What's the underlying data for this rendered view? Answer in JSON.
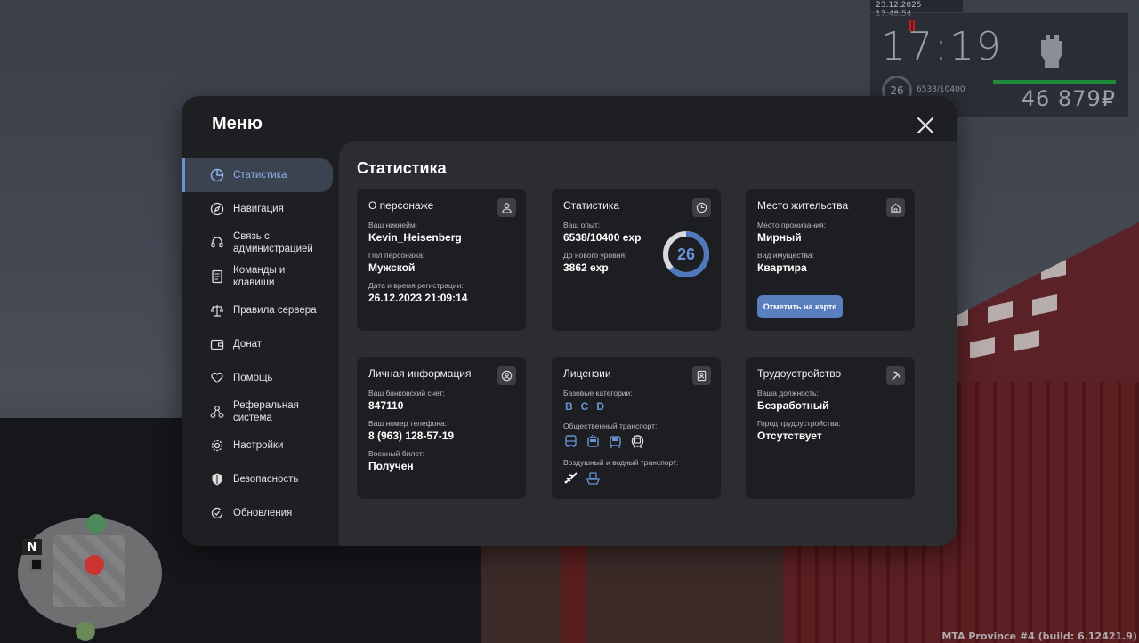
{
  "hud": {
    "datetime": "23.12.2025 17:48:54",
    "time": "17:19",
    "level": "26",
    "exp": "6538/10400",
    "money": "46 879₽"
  },
  "minimap": {
    "north": "N"
  },
  "build": "MTA Province #4 (build: 6.12421.9)",
  "menu": {
    "title": "Меню",
    "sidebar": [
      {
        "label": "Статистика",
        "icon": "pie-chart-icon",
        "active": true
      },
      {
        "label": "Навигация",
        "icon": "compass-icon"
      },
      {
        "label": "Связь с администрацией",
        "icon": "headset-icon"
      },
      {
        "label": "Команды и клавиши",
        "icon": "document-icon"
      },
      {
        "label": "Правила сервера",
        "icon": "scales-icon"
      },
      {
        "label": "Донат",
        "icon": "wallet-icon"
      },
      {
        "label": "Помощь",
        "icon": "heart-hand-icon"
      },
      {
        "label": "Реферальная система",
        "icon": "network-icon"
      },
      {
        "label": "Настройки",
        "icon": "gear-icon"
      },
      {
        "label": "Безопасность",
        "icon": "shield-icon"
      },
      {
        "label": "Обновления",
        "icon": "refresh-check-icon"
      }
    ],
    "content_title": "Статистика",
    "cards": {
      "character": {
        "title": "О персонаже",
        "nickname_label": "Ваш никнейм:",
        "nickname": "Kevin_Heisenberg",
        "gender_label": "Пол персонажа:",
        "gender": "Мужской",
        "reg_label": "Дата и время регистрации:",
        "reg": "26.12.2023 21:09:14"
      },
      "stats": {
        "title": "Статистика",
        "exp_label": "Ваш опыт:",
        "exp": "6538/10400 exp",
        "next_label": "До нового уровня:",
        "next": "3862 exp",
        "level": "26",
        "level_progress": 0.6287
      },
      "residence": {
        "title": "Место жительства",
        "place_label": "Место проживания:",
        "place": "Мирный",
        "property_label": "Вид имущества:",
        "property": "Квартира",
        "map_button": "Отметить на карте"
      },
      "personal": {
        "title": "Личная информация",
        "bank_label": "Ваш банковский счет:",
        "bank": "847110",
        "phone_label": "Ваш номер телефона:",
        "phone": "8 (963) 128-57-19",
        "military_label": "Военный билет:",
        "military": "Получен"
      },
      "licenses": {
        "title": "Лицензии",
        "base_label": "Базовые категории:",
        "base": [
          "B",
          "C",
          "D"
        ],
        "public_label": "Общественный транспорт:",
        "public_icons": [
          "bus-icon",
          "trolleybus-icon",
          "tram-icon",
          "subway-icon"
        ],
        "air_label": "Воздушный и водный транспорт:",
        "air_icons": [
          "airplane-icon",
          "ship-icon"
        ]
      },
      "job": {
        "title": "Трудоустройство",
        "position_label": "Ваша должность:",
        "position": "Безработный",
        "city_label": "Город трудоустройства:",
        "city": "Отсутствует"
      }
    }
  }
}
